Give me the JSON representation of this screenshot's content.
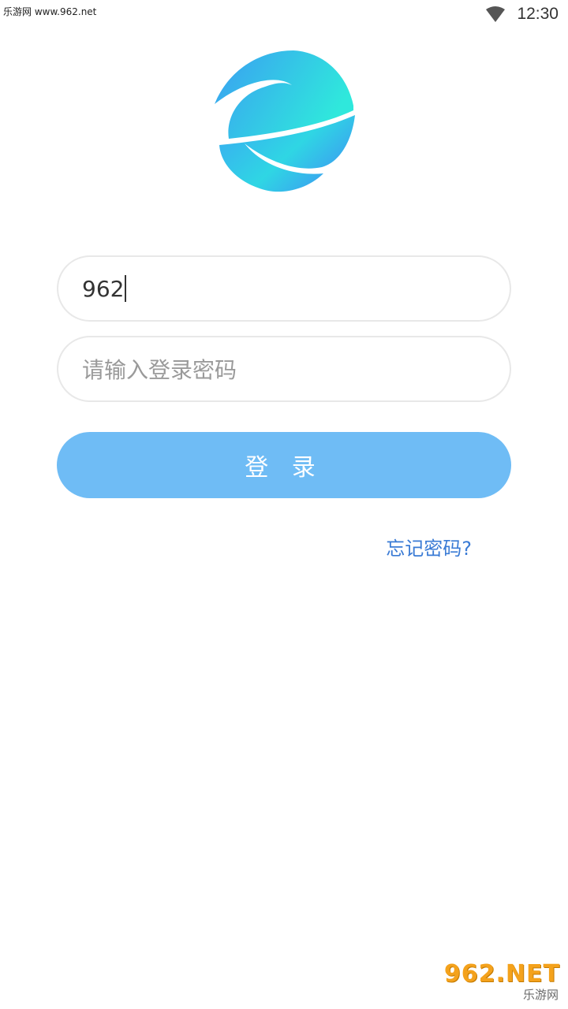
{
  "status_bar": {
    "watermark": "乐游网 www.962.net",
    "time": "12:30",
    "wifi_icon": "wifi-icon"
  },
  "logo": {
    "icon": "app-logo",
    "colors": [
      "#3aa0f0",
      "#2ee5dc"
    ]
  },
  "login_form": {
    "username_value": "962",
    "password_placeholder": "请输入登录密码",
    "login_label": "登 录",
    "forgot_label": "忘记密码?"
  },
  "colors": {
    "button": "#6fbcf5",
    "link": "#3a7bd5",
    "field_border": "#e8e8e8"
  },
  "watermark_bottom": {
    "big": "962.NET",
    "small": "乐游网"
  }
}
